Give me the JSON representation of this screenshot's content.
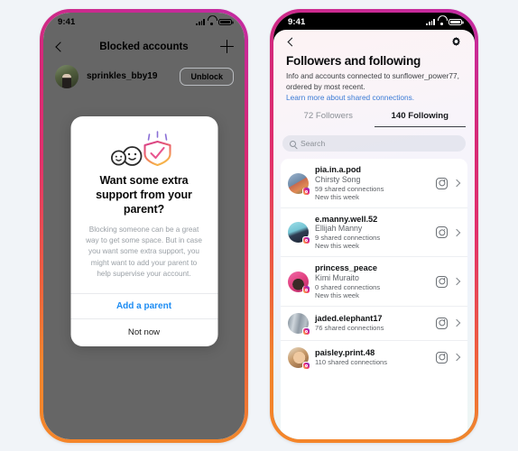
{
  "colors": {
    "page_background": "#f1f4f8",
    "frame_gradient_start": "#c32aa3",
    "frame_gradient_end": "#f58529",
    "link_blue": "#3a7bd5",
    "action_blue": "#1c8cf3"
  },
  "left_phone": {
    "status_bar": {
      "time": "9:41"
    },
    "nav": {
      "back_icon": "chevron-left-icon",
      "title": "Blocked accounts",
      "add_icon": "plus-icon"
    },
    "blocked_account": {
      "username": "sprinkles_bby19",
      "action_label": "Unblock"
    },
    "modal": {
      "illustration": "two-faces-and-shield-check-icon",
      "title": "Want some extra support from your parent?",
      "body": "Blocking someone can be a great way to get some space. But in case you want some extra support, you might want to add your parent to help supervise your account.",
      "primary_action": "Add a parent",
      "secondary_action": "Not now"
    }
  },
  "right_phone": {
    "status_bar": {
      "time": "9:41"
    },
    "nav": {
      "back_icon": "chevron-left-icon",
      "settings_icon": "gear-icon"
    },
    "header": {
      "title": "Followers and following",
      "subtitle": "Info and accounts connected to sunflower_power77, ordered by most recent.",
      "link": "Learn more about shared connections."
    },
    "tabs": [
      {
        "label": "72 Followers",
        "active": false
      },
      {
        "label": "140 Following",
        "active": true
      }
    ],
    "search": {
      "placeholder": "Search",
      "icon": "search-icon"
    },
    "list": [
      {
        "handle": "pia.in.a.pod",
        "name": "Chirsty Song",
        "shared": "59 shared connections",
        "new": "New this week",
        "avatar_color": "#8ba3bd"
      },
      {
        "handle": "e.manny.well.52",
        "name": "Ellijah Manny",
        "shared": "9 shared connections",
        "new": "New this week",
        "avatar_color": "#7ec9d6"
      },
      {
        "handle": "princess_peace",
        "name": "Kimi Muraito",
        "shared": "0 shared connections",
        "new": "New this week",
        "avatar_color": "#e8509b"
      },
      {
        "handle": "jaded.elephant17",
        "name": "",
        "shared": "76 shared connections",
        "new": "",
        "avatar_color": "#9aa3ae"
      },
      {
        "handle": "paisley.print.48",
        "name": "",
        "shared": "110 shared connections",
        "new": "",
        "avatar_color": "#c99a6e"
      }
    ]
  }
}
